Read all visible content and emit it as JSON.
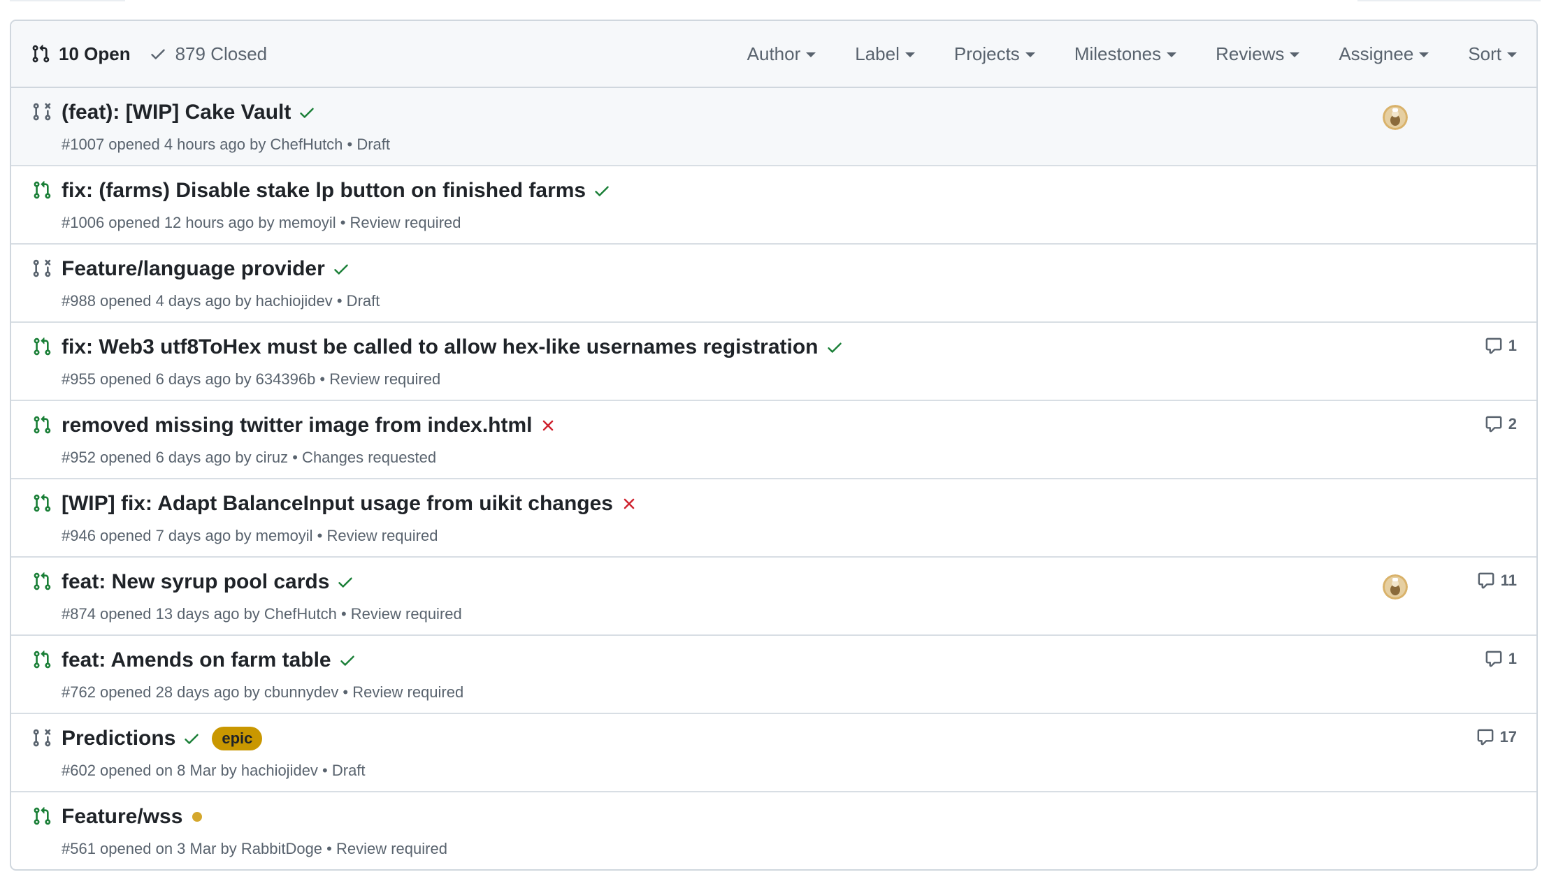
{
  "states": {
    "open_label": "10 Open",
    "closed_label": "879 Closed"
  },
  "filters": [
    {
      "label": "Author"
    },
    {
      "label": "Label"
    },
    {
      "label": "Projects"
    },
    {
      "label": "Milestones"
    },
    {
      "label": "Reviews"
    },
    {
      "label": "Assignee"
    },
    {
      "label": "Sort"
    }
  ],
  "colors": {
    "open_green": "#1a7f37",
    "draft_gray": "#59636e",
    "fail_red": "#cf222e",
    "pending_yellow": "#d4a72c",
    "epic_bg": "#c99700"
  },
  "pull_requests": [
    {
      "title": "(feat): [WIP] Cake Vault",
      "meta": "#1007 opened 4 hours ago by ChefHutch • Draft",
      "state": "draft",
      "status": "success",
      "avatar": true,
      "comments": ""
    },
    {
      "title": "fix: (farms) Disable stake lp button on finished farms",
      "meta": "#1006 opened 12 hours ago by memoyil • Review required",
      "state": "open",
      "status": "success",
      "avatar": false,
      "comments": ""
    },
    {
      "title": "Feature/language provider",
      "meta": "#988 opened 4 days ago by hachiojidev • Draft",
      "state": "draft",
      "status": "success",
      "avatar": false,
      "comments": ""
    },
    {
      "title": "fix: Web3 utf8ToHex must be called to allow hex-like usernames registration",
      "meta": "#955 opened 6 days ago by 634396b • Review required",
      "state": "open",
      "status": "success",
      "avatar": false,
      "comments": "1"
    },
    {
      "title": "removed missing twitter image from index.html",
      "meta": "#952 opened 6 days ago by ciruz • Changes requested",
      "state": "open",
      "status": "failure",
      "avatar": false,
      "comments": "2"
    },
    {
      "title": "[WIP] fix: Adapt BalanceInput usage from uikit changes",
      "meta": "#946 opened 7 days ago by memoyil • Review required",
      "state": "open",
      "status": "failure",
      "avatar": false,
      "comments": ""
    },
    {
      "title": "feat: New syrup pool cards",
      "meta": "#874 opened 13 days ago by ChefHutch • Review required",
      "state": "open",
      "status": "success",
      "avatar": true,
      "comments": "11"
    },
    {
      "title": "feat: Amends on farm table",
      "meta": "#762 opened 28 days ago by cbunnydev • Review required",
      "state": "open",
      "status": "success",
      "avatar": false,
      "comments": "1"
    },
    {
      "title": "Predictions",
      "meta": "#602 opened on 8 Mar by hachiojidev • Draft",
      "state": "draft",
      "status": "success",
      "avatar": false,
      "comments": "17",
      "label": "epic"
    },
    {
      "title": "Feature/wss",
      "meta": "#561 opened on 3 Mar by RabbitDoge • Review required",
      "state": "open",
      "status": "pending",
      "avatar": false,
      "comments": ""
    }
  ]
}
